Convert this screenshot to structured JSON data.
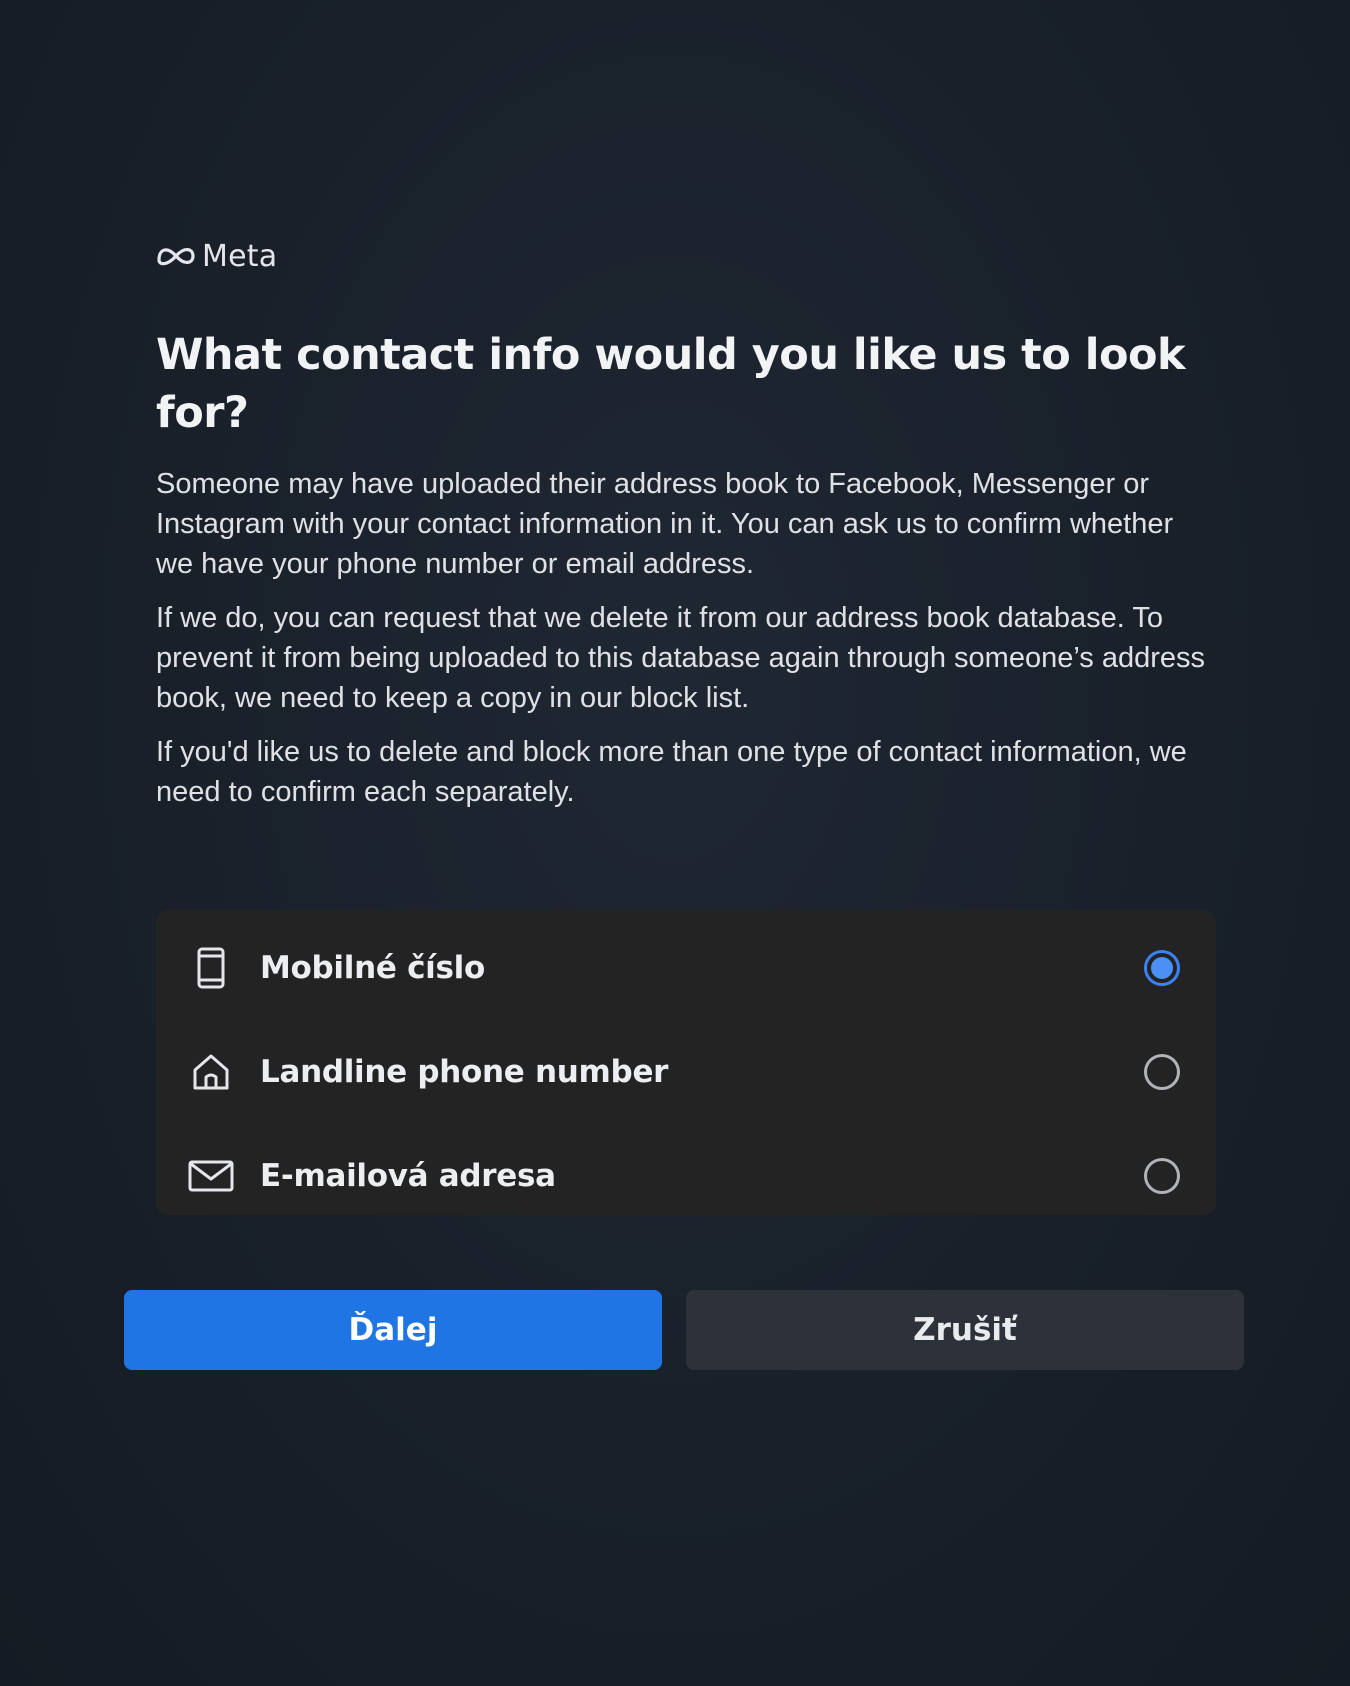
{
  "brand": {
    "name": "Meta",
    "logo_icon": "meta-infinity-logo"
  },
  "dialog": {
    "title": "What contact info would you like us to look for?",
    "paragraphs": [
      "Someone may have uploaded their address book to Facebook, Messenger or Instagram with your contact information in it. You can ask us to confirm whether we have your phone number or email address.",
      "If we do, you can request that we delete it from our address book database. To prevent it from being uploaded to this database again through someone’s address book, we need to keep a copy in our block list.",
      "If you'd like us to delete and block more than one type of contact information, we need to confirm each separately."
    ],
    "options": [
      {
        "label": "Mobilné číslo",
        "icon": "mobile-phone-icon",
        "selected": true
      },
      {
        "label": "Landline phone number",
        "icon": "home-icon",
        "selected": false
      },
      {
        "label": "E-mailová adresa",
        "icon": "envelope-icon",
        "selected": false
      }
    ],
    "buttons": {
      "next": "Ďalej",
      "cancel": "Zrušiť"
    }
  },
  "colors": {
    "background": "#19202a",
    "primary": "#1f75e3",
    "secondary": "#2c313a",
    "radio_selected": "#4a90f5",
    "options_panel": "#232323"
  }
}
